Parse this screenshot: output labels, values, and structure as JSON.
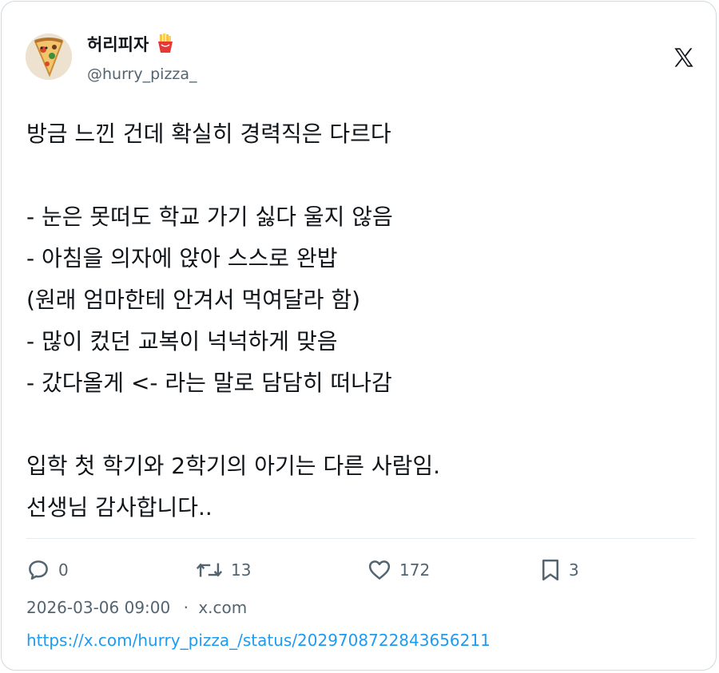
{
  "author": {
    "display_name": "허리피자",
    "name_emoji": "fries-emoji",
    "handle": "@hurry_pizza_"
  },
  "platform_icon": "x-logo-icon",
  "tweet": {
    "text_lines": [
      "방금 느낀 건데 확실히 경력직은 다르다",
      "",
      "- 눈은 못떠도 학교 가기 싫다 울지 않음",
      "- 아침을 의자에 앉아 스스로 완밥",
      "(원래 엄마한테 안겨서 먹여달라 함)",
      "- 많이 컸던 교복이 넉넉하게 맞음",
      "- 갔다올게 <- 라는 말로 담담히 떠나감",
      "",
      "입학 첫 학기와 2학기의 아기는 다른 사람임.",
      "선생님 감사합니다.."
    ]
  },
  "actions": {
    "reply": {
      "icon": "reply-icon",
      "count": "0"
    },
    "retweet": {
      "icon": "retweet-icon",
      "count": "13"
    },
    "like": {
      "icon": "heart-icon",
      "count": "172"
    },
    "bookmark": {
      "icon": "bookmark-icon",
      "count": "3"
    }
  },
  "meta": {
    "timestamp": "2026-03-06 09:00",
    "separator": "·",
    "source": "x.com"
  },
  "status_url": "https://x.com/hurry_pizza_/status/2029708722843656211",
  "colors": {
    "text": "#0f1419",
    "muted": "#536471",
    "link": "#1d9bf0",
    "border": "#cfd9de"
  }
}
